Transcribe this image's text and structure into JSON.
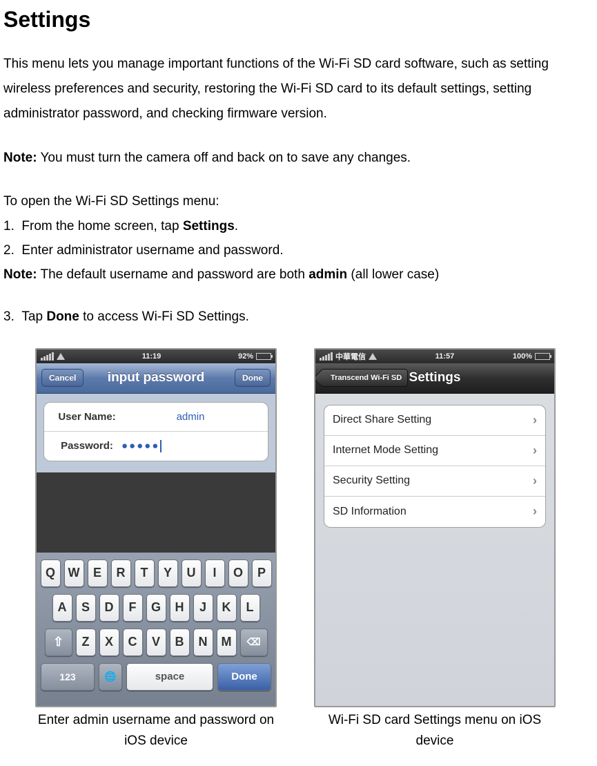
{
  "heading": "Settings",
  "paragraph1": "This menu lets you manage important functions of the Wi-Fi SD card software, such as setting wireless preferences and security, restoring the Wi-Fi SD card to its default settings, setting administrator password, and checking firmware version.",
  "note1_prefix": "Note:",
  "note1_text": " You must turn the camera off and back on to save any changes.",
  "intro_line": "To open the Wi-Fi SD Settings menu:",
  "steps": {
    "s1_num": "1.",
    "s1_text_a": "From the home screen, tap ",
    "s1_bold": "Settings",
    "s1_text_b": ".",
    "s2_num": "2.",
    "s2_text": "Enter administrator username and password.",
    "s3_num": "3.",
    "s3_text_a": "Tap ",
    "s3_bold": "Done",
    "s3_text_b": " to access Wi-Fi SD Settings."
  },
  "note2_prefix": "Note:",
  "note2_text_a": " The default username and password are both ",
  "note2_bold": "admin",
  "note2_text_b": " (all lower case)",
  "captions": {
    "left": "Enter admin username and password on iOS device",
    "right": "Wi-Fi SD card Settings menu on iOS device"
  },
  "phone1": {
    "statusbar": {
      "time": "11:19",
      "battery": "92%",
      "carrier": ""
    },
    "nav": {
      "cancel": "Cancel",
      "title": "input password",
      "done": "Done"
    },
    "form": {
      "username_label": "User Name:",
      "username_value": "admin",
      "password_label": "Password:",
      "password_value": "●●●●●"
    },
    "keyboard": {
      "row1": [
        "Q",
        "W",
        "E",
        "R",
        "T",
        "Y",
        "U",
        "I",
        "O",
        "P"
      ],
      "row2": [
        "A",
        "S",
        "D",
        "F",
        "G",
        "H",
        "J",
        "K",
        "L"
      ],
      "row3": [
        "Z",
        "X",
        "C",
        "V",
        "B",
        "N",
        "M"
      ],
      "shift": "⇧",
      "del": "⌫",
      "num": "123",
      "globe": "🌐",
      "space": "space",
      "done": "Done"
    }
  },
  "phone2": {
    "statusbar": {
      "carrier": "中華電信",
      "time": "11:57",
      "battery": "100%"
    },
    "nav": {
      "back": "Transcend Wi-Fi SD",
      "title": "Settings"
    },
    "menu": [
      "Direct Share Setting",
      "Internet Mode Setting",
      "Security Setting",
      "SD Information"
    ]
  }
}
